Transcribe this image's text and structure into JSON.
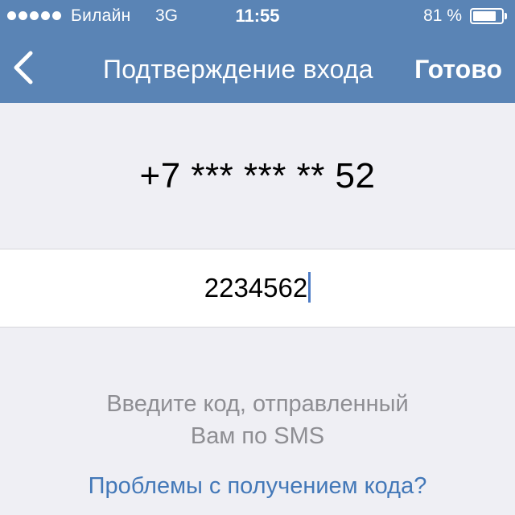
{
  "status_bar": {
    "signal_dots": 5,
    "carrier": "Билайн",
    "network": "3G",
    "time": "11:55",
    "battery_percent": "81 %",
    "battery_level": 0.81
  },
  "nav": {
    "back_icon": "chevron-left-icon",
    "title": "Подтверждение входа",
    "done_label": "Готово"
  },
  "phone": {
    "masked_number": "+7 *** *** ** 52"
  },
  "code_field": {
    "value": "2234562"
  },
  "hint": {
    "line1": "Введите код, отправленный",
    "line2": "Вам по SMS"
  },
  "problems_link": "Проблемы с получением кода?",
  "colors": {
    "header_bg": "#5a84b5",
    "page_bg": "#efeff4",
    "link": "#4378b8",
    "hint_text": "#8e8e93",
    "caret": "#4d7cc6"
  }
}
